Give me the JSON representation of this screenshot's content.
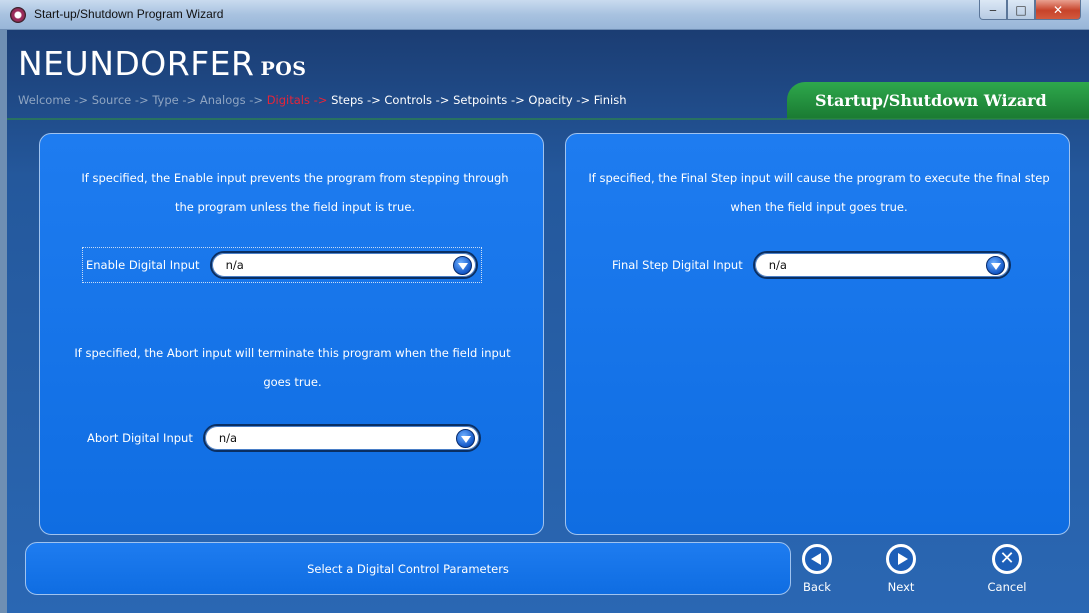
{
  "window": {
    "title": "Start-up/Shutdown Program Wizard",
    "min_glyph": "‒",
    "max_glyph": "□",
    "close_glyph": "✕"
  },
  "brand": {
    "name": "NEUNDORFER",
    "sub": "POS"
  },
  "wizard_title": "Startup/Shutdown Wizard",
  "breadcrumb": {
    "separator": "->",
    "steps": [
      "Welcome",
      "Source",
      "Type",
      "Analogs",
      "Digitals",
      "Steps",
      "Controls",
      "Setpoints",
      "Opacity",
      "Finish"
    ],
    "current": "Digitals"
  },
  "left_panel": {
    "enable_desc": "If specified, the Enable input prevents the program from stepping through the program unless the field input is true.",
    "enable_label": "Enable Digital Input",
    "enable_value": "n/a",
    "abort_desc": "If specified, the Abort input will terminate this program when the field input goes true.",
    "abort_label": "Abort Digital Input",
    "abort_value": "n/a"
  },
  "right_panel": {
    "final_desc": "If specified, the Final Step input will cause the program to execute the final step when the field input goes true.",
    "final_label": "Final Step Digital Input",
    "final_value": "n/a"
  },
  "status_text": "Select a Digital Control Parameters",
  "nav": {
    "back": "Back",
    "next": "Next",
    "cancel": "Cancel",
    "cancel_glyph": "✕"
  },
  "colors": {
    "accent_green": "#2ea84c",
    "current_step": "#e4253a",
    "panel_blue": "#1e7cf0"
  }
}
